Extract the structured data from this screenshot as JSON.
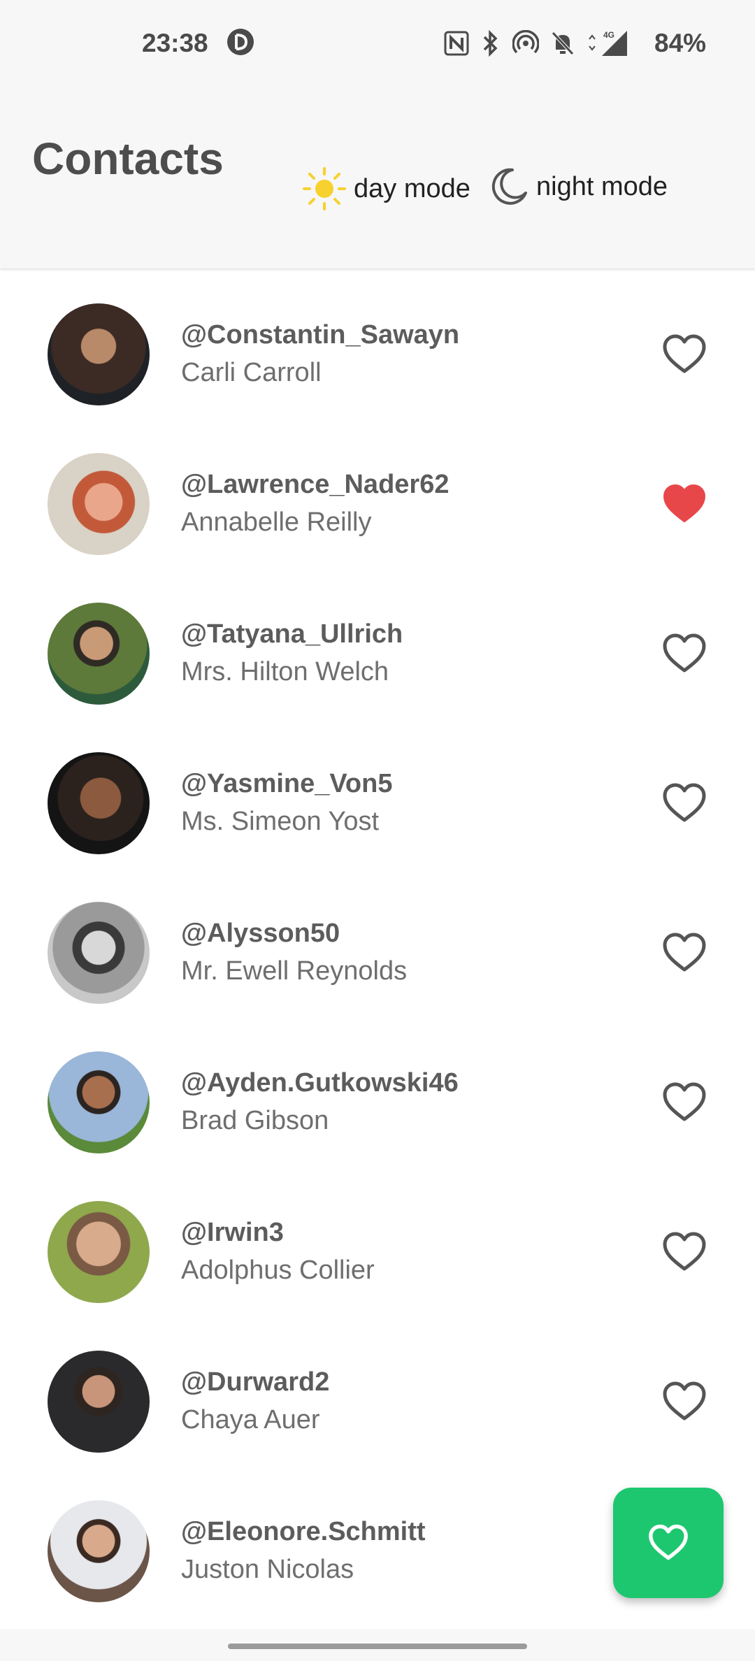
{
  "status_bar": {
    "time": "23:38",
    "battery": "84%",
    "network": "4G"
  },
  "header": {
    "title": "Contacts",
    "day_mode_label": "day mode",
    "night_mode_label": "night mode"
  },
  "colors": {
    "accent_green": "#1dc76f",
    "heart_active": "#e8474a",
    "sun_yellow": "#f7d12e"
  },
  "contacts": [
    {
      "handle": "@Constantin_Sawayn",
      "name": "Carli Carroll",
      "favorite": false
    },
    {
      "handle": "@Lawrence_Nader62",
      "name": "Annabelle Reilly",
      "favorite": true
    },
    {
      "handle": "@Tatyana_Ullrich",
      "name": "Mrs. Hilton Welch",
      "favorite": false
    },
    {
      "handle": "@Yasmine_Von5",
      "name": "Ms. Simeon Yost",
      "favorite": false
    },
    {
      "handle": "@Alysson50",
      "name": "Mr. Ewell Reynolds",
      "favorite": false
    },
    {
      "handle": "@Ayden.Gutkowski46",
      "name": "Brad Gibson",
      "favorite": false
    },
    {
      "handle": "@Irwin3",
      "name": "Adolphus Collier",
      "favorite": false
    },
    {
      "handle": "@Durward2",
      "name": "Chaya Auer",
      "favorite": false
    },
    {
      "handle": "@Eleonore.Schmitt",
      "name": "Juston Nicolas",
      "favorite": false
    }
  ],
  "fab": {
    "icon": "heart-icon"
  }
}
